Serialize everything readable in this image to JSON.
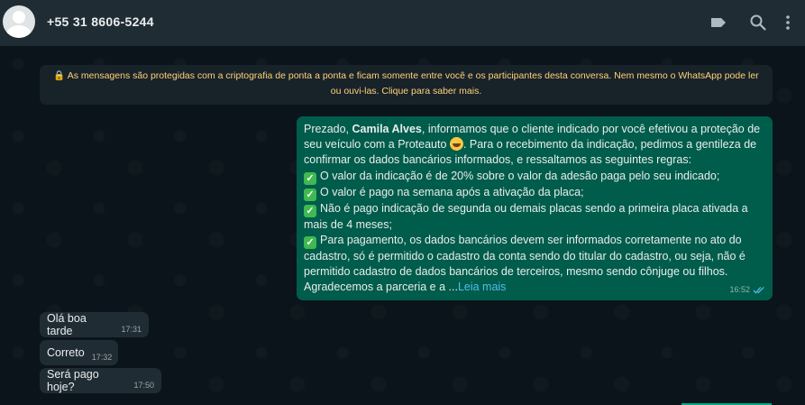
{
  "header": {
    "contact_name": "+55 31 8606-5244",
    "icons": [
      "label-icon",
      "search-icon",
      "menu-icon"
    ]
  },
  "notice": {
    "text": "🔒 As mensagens são protegidas com a criptografia de ponta a ponta e ficam somente entre você e os participantes desta conversa. Nem mesmo o WhatsApp pode ler ou ouvi-las. Clique para saber mais."
  },
  "outgoing_message": {
    "intro_prefix": "Prezado, ",
    "name_bold": "Camila Alves",
    "intro_suffix": ", informamos que o cliente indicado por você efetivou a proteção de seu veículo com a Proteauto",
    "intro_tail": ". Para o recebimento da indicação, pedimos a gentileza de confirmar os dados bancários informados, e ressaltamos as seguintes regras:",
    "rules": [
      "O valor da indicação é de 20% sobre o valor da adesão paga pelo seu indicado;",
      "O valor é pago na semana após a ativação da placa;",
      "Não é pago indicação de segunda ou demais placas sendo a primeira placa ativada a mais de 4 meses;",
      "Para pagamento, os dados bancários devem ser informados corretamente no ato do cadastro, só é permitido o cadastro da conta sendo do titular do cadastro, ou seja, não é permitido cadastro de dados bancários de terceiros, mesmo sendo cônjuge ou filhos."
    ],
    "closing": "Agradecemos a parceria e a ...",
    "read_more": "Leia mais",
    "time": "16:52"
  },
  "incoming_messages": [
    {
      "text": "Olá boa tarde",
      "time": "17:31"
    },
    {
      "text": "Correto",
      "time": "17:32"
    },
    {
      "text": "Será pago hoje?",
      "time": "17:50"
    }
  ],
  "colors": {
    "header_bg": "#202c33",
    "chat_bg": "#0b141a",
    "outgoing_bubble": "#005c4b",
    "incoming_bubble": "#202c33",
    "notice_text": "#ffd279",
    "link": "#53bdeb"
  }
}
